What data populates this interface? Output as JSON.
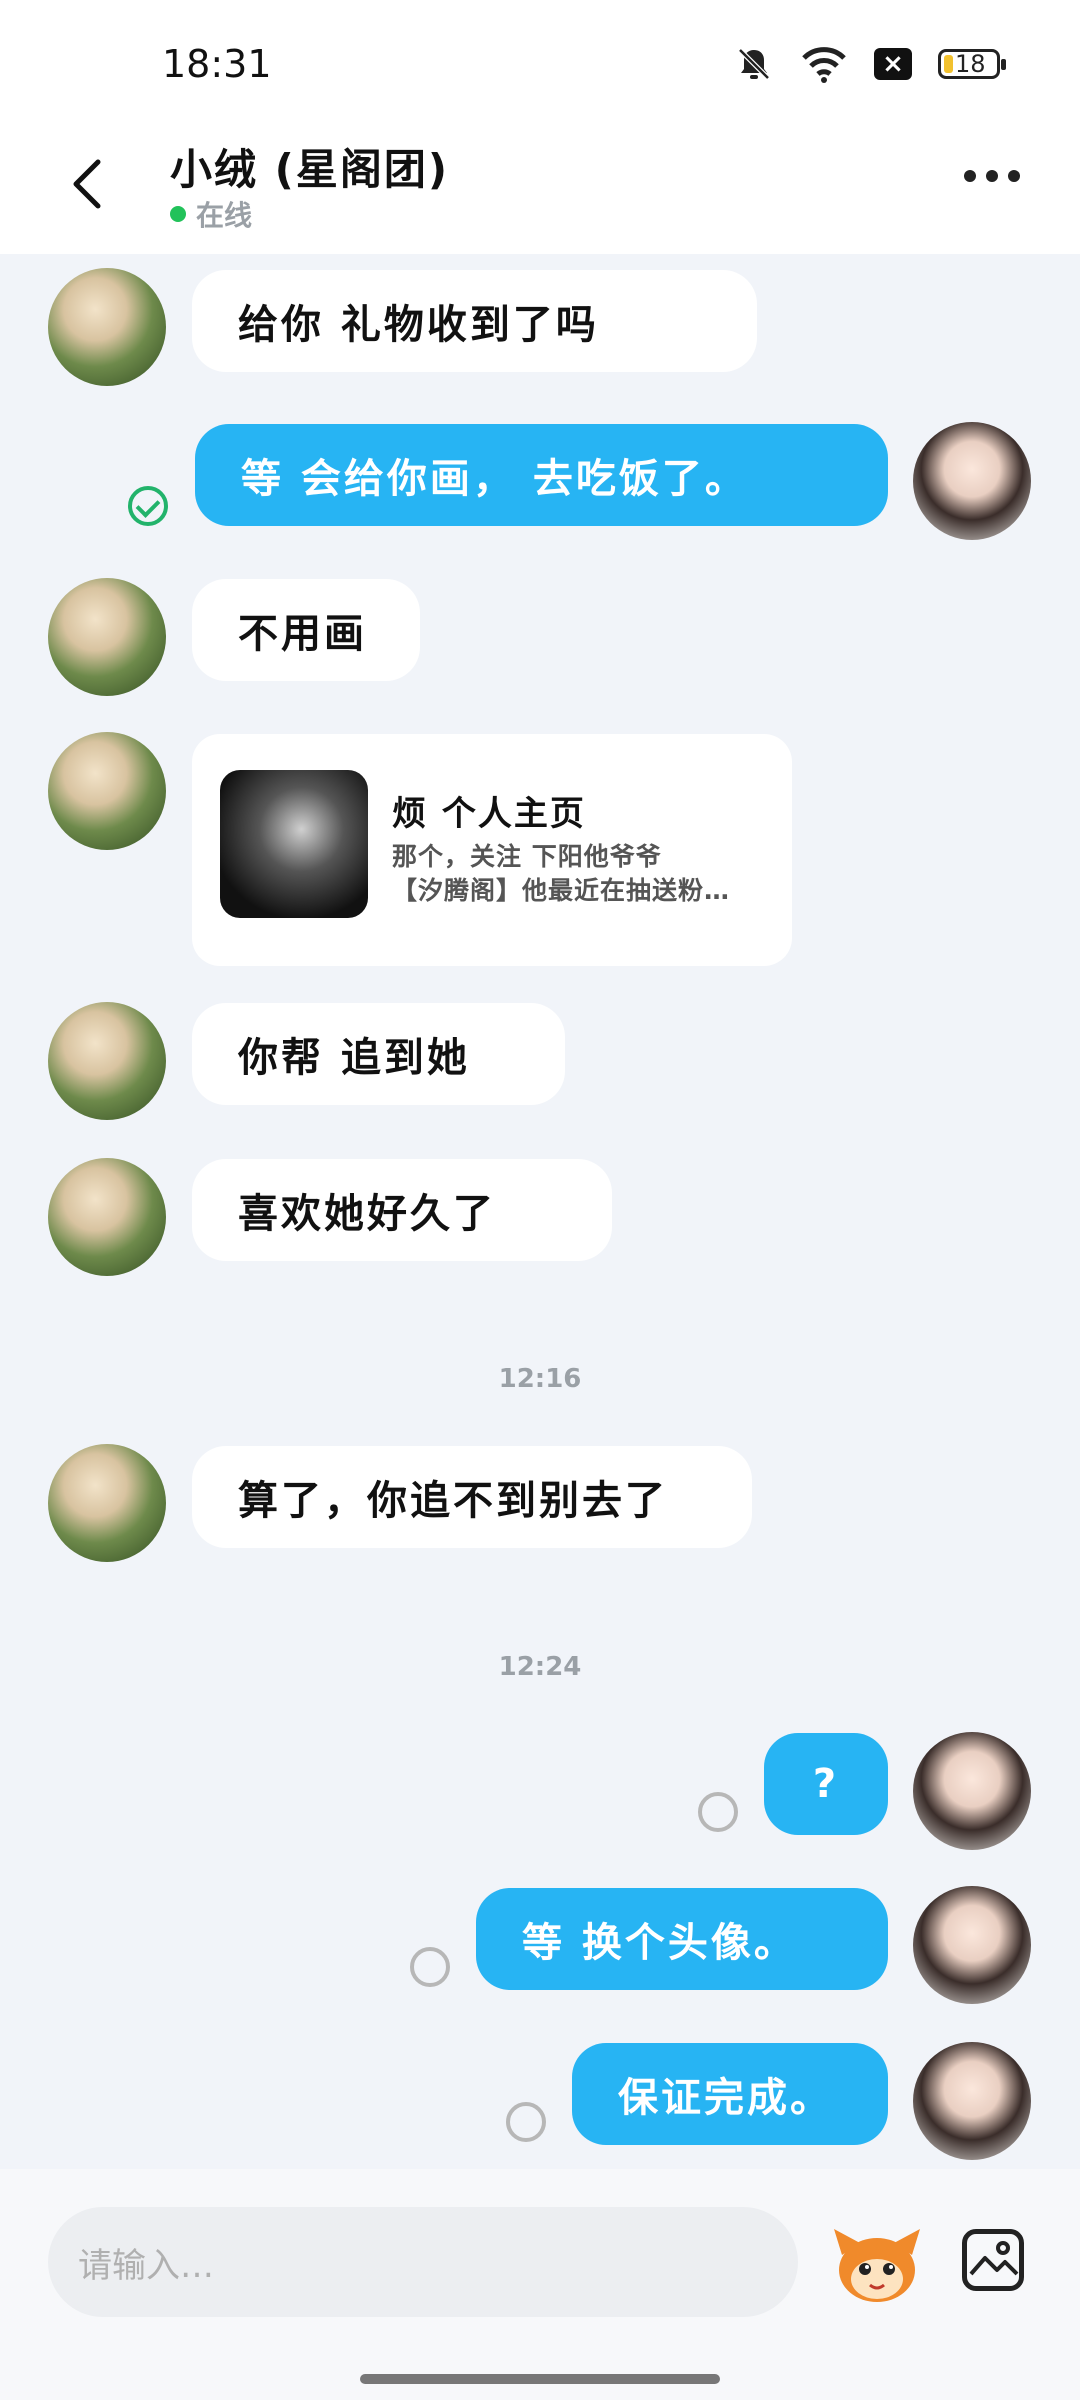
{
  "status_bar": {
    "time": "18:31",
    "battery": "18"
  },
  "header": {
    "title": "小绒  (星阁团)",
    "status": "在线"
  },
  "messages": [
    {
      "text": "给你  礼物收到了吗"
    },
    {
      "text": "等 会给你画，  去吃饭了。"
    },
    {
      "text": "不用画"
    },
    {
      "text": "你帮  追到她"
    },
    {
      "text": "  喜欢她好久了"
    },
    {
      "text": "算了，你追不到别去了"
    },
    {
      "text": "?"
    },
    {
      "text": "等  换个头像。"
    },
    {
      "text": "保证完成。"
    }
  ],
  "card": {
    "title": "烦  个人主页",
    "line1": "那个，关注  下阳他爷爷",
    "line2": "【汐腾阁】他最近在抽送粉…"
  },
  "timestamps": [
    "12:16",
    "12:24"
  ],
  "input": {
    "placeholder": "请输入…"
  },
  "icons": {
    "back": "chevron-left-icon",
    "more": "more-dots-icon",
    "read": "check-circle-icon",
    "pending": "pending-circle-icon",
    "sticker": "mascot-sticker-icon",
    "image": "image-icon"
  }
}
